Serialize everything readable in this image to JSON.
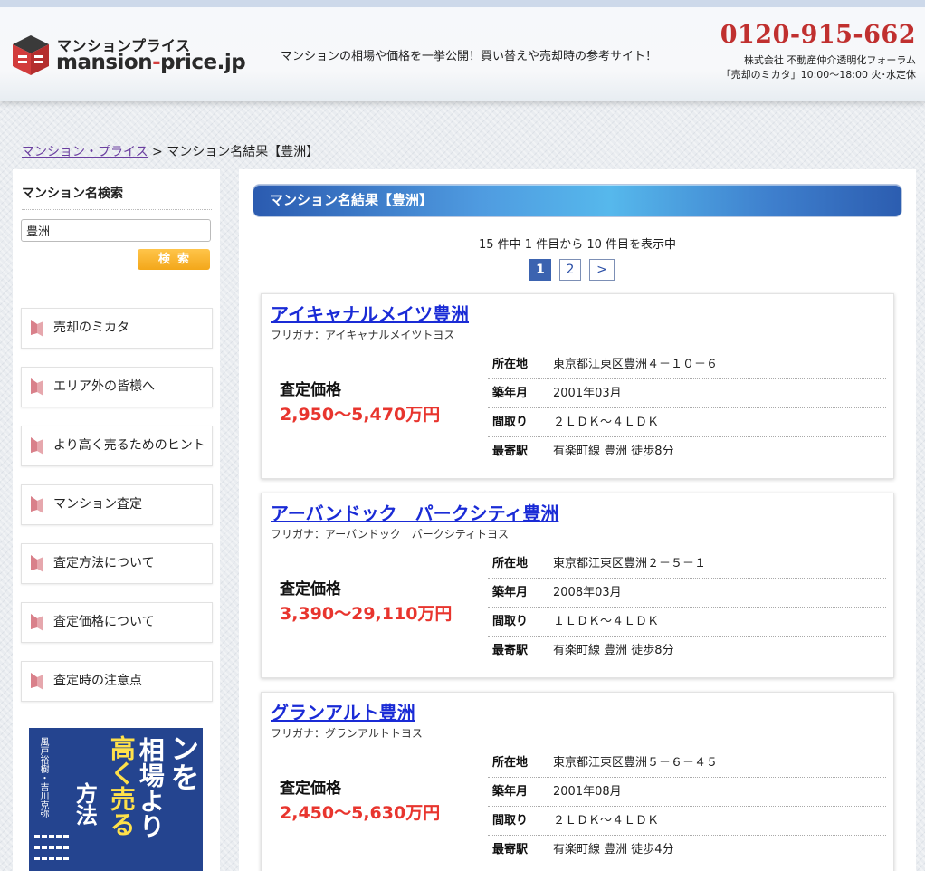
{
  "header": {
    "logo_kana": "マンションプライス",
    "logo_roman_1": "mansion",
    "logo_roman_dash": "-",
    "logo_roman_2": "price.jp",
    "tagline": "マンションの相場や価格を一挙公開！買い替えや売却時の参考サイト！",
    "phone": "0120-915-662",
    "company": "株式会社 不動産仲介透明化フォーラム",
    "hours": "「売却のミカタ」10:00～18:00 火･水定休"
  },
  "breadcrumb": {
    "home": "マンション・プライス",
    "separator": " > ",
    "current": "マンション名結果【豊洲】"
  },
  "sidebar": {
    "search_title": "マンション名検索",
    "search_value": "豊洲",
    "search_button": "検索",
    "menu": [
      "売却のミカタ",
      "エリア外の皆様へ",
      "より高く売るためのヒント",
      "マンション査定",
      "査定方法について",
      "査定価格について",
      "査定時の注意点"
    ],
    "book": {
      "title_main": "マンションを",
      "title_sub": "相場より",
      "title_accent": "高く売る",
      "title_end": "方法",
      "author": "風戸裕樹・吉川克弥"
    }
  },
  "main": {
    "heading": "マンション名結果【豊洲】",
    "count": "15 件中 1 件目から 10 件目を表示中",
    "pager": [
      "1",
      "2",
      ">"
    ],
    "price_label": "査定価格",
    "spec_keys": [
      "所在地",
      "築年月",
      "間取り",
      "最寄駅"
    ],
    "results": [
      {
        "name": "アイキャナルメイツ豊洲",
        "furigana": "フリガナ：アイキャナルメイツトヨス",
        "price": "2,950～5,470万円",
        "address": "東京都江東区豊洲４－１０－６",
        "built": "2001年03月",
        "layout": "２ＬＤＫ～４ＬＤＫ",
        "station": "有楽町線 豊洲 徒歩8分"
      },
      {
        "name": "アーバンドック　パークシティ豊洲",
        "furigana": "フリガナ：アーバンドック　パークシティトヨス",
        "price": "3,390～29,110万円",
        "address": "東京都江東区豊洲２－５－１",
        "built": "2008年03月",
        "layout": "１ＬＤＫ～４ＬＤＫ",
        "station": "有楽町線 豊洲 徒歩8分"
      },
      {
        "name": "グランアルト豊洲",
        "furigana": "フリガナ：グランアルトトヨス",
        "price": "2,450～5,630万円",
        "address": "東京都江東区豊洲５－６－４５",
        "built": "2001年08月",
        "layout": "２ＬＤＫ～４ＬＤＫ",
        "station": "有楽町線 豊洲 徒歩4分"
      }
    ]
  }
}
